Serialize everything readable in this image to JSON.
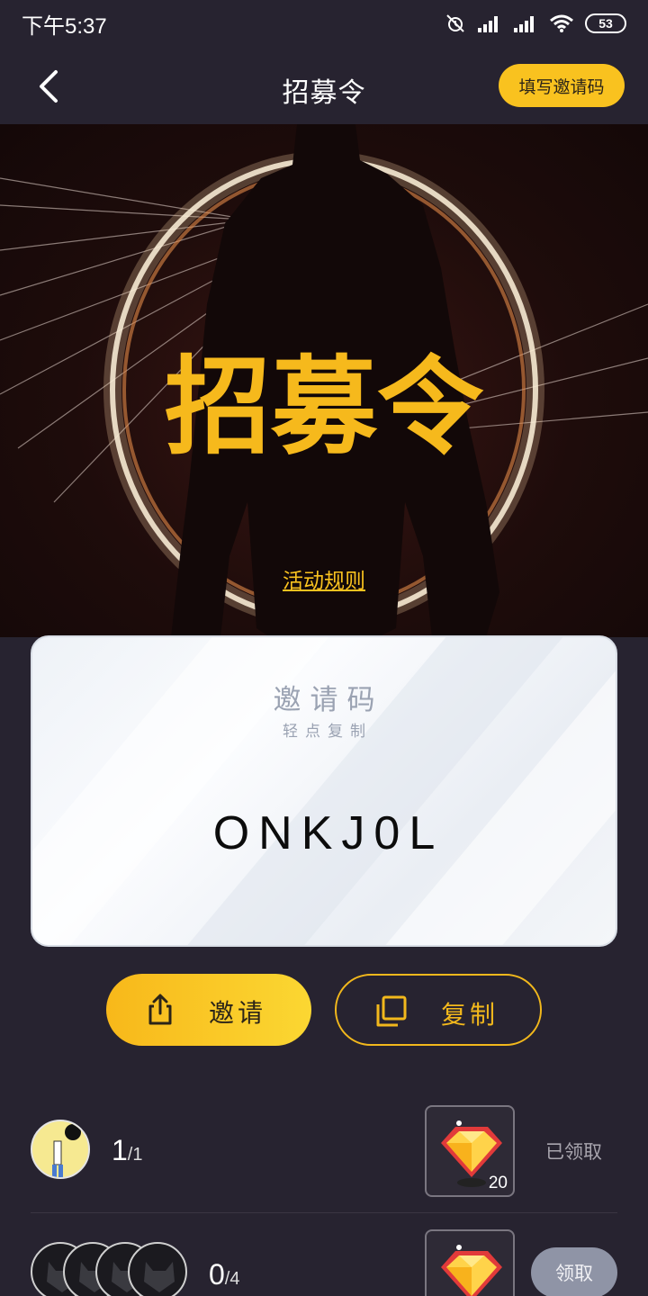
{
  "status_bar": {
    "time": "下午5:37",
    "battery": "53",
    "icons": [
      "alarm-off-icon",
      "signal-icon",
      "signal-icon",
      "wifi-icon",
      "battery-icon"
    ]
  },
  "header": {
    "back_icon": "chevron-left-icon",
    "title": "招募令",
    "invite_code_button": "填写邀请码"
  },
  "hero": {
    "artwork_title": "招募令",
    "rules_link": "活动规则"
  },
  "invite_card": {
    "label": "邀请码",
    "hint": "轻点复制",
    "code": "ONKJ0L"
  },
  "actions": {
    "invite": {
      "label": "邀请",
      "icon": "share-icon"
    },
    "copy": {
      "label": "复制",
      "icon": "copy-icon"
    }
  },
  "rewards": [
    {
      "current": "1",
      "total": "/1",
      "reward_count": "20",
      "status": "已领取",
      "icon": "gem-icon"
    },
    {
      "current": "0",
      "total": "/4",
      "status": "领取",
      "icon": "gem-icon"
    }
  ],
  "colors": {
    "background": "#272330",
    "accent": "#f9c21f",
    "claim_button": "#8f94a6"
  }
}
